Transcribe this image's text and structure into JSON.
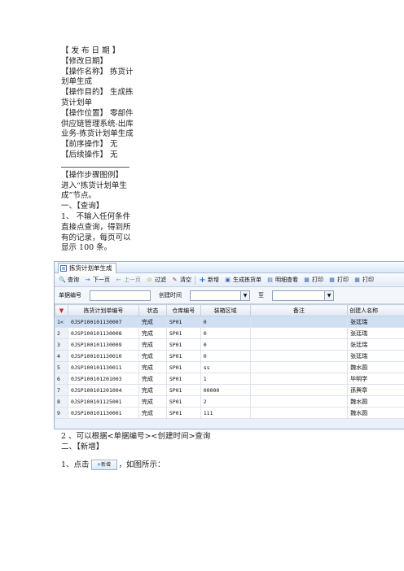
{
  "doc": {
    "lines": [
      "【 发 布 日 期 】",
      "【修改日期】",
      "【操作名称】 拣货计划单生成",
      "【操作目的】 生成拣货计划单",
      "【操作位置】 零部件供应链管理系统-出库业务-拣货计划单生成",
      "【前序操作】 无",
      "【后续操作】 无"
    ],
    "lines2": [
      "【操作步骤图例】",
      "进入“拣货计划单生成”节点。",
      "一、【查询】",
      "1、 不输入任何条件直接点查询，得到所有的记录，每页可以显示 100 条。"
    ],
    "after1": "2 、可以根据<单据编号><创建时间>查询",
    "after2": "二、【新增】",
    "after3_pre": "1、点击",
    "after3_btn": "新增",
    "after3_post": "，如图所示："
  },
  "app": {
    "tab_title": "拣货计划单生成",
    "toolbar": [
      {
        "icon": "search-icon",
        "label": "查询",
        "glyph": "🔍"
      },
      {
        "icon": "next-page-icon",
        "label": "下一页",
        "glyph": "→"
      },
      {
        "icon": "prev-page-icon",
        "label": "上一页",
        "glyph": "←"
      },
      {
        "icon": "filter-icon",
        "label": "过滤",
        "glyph": "⊙"
      },
      {
        "icon": "clear-icon",
        "label": "清空",
        "glyph": "✎"
      },
      {
        "icon": "add-icon",
        "label": "新增",
        "glyph": "+"
      },
      {
        "icon": "generate-icon",
        "label": "生成拣货单",
        "glyph": "▣"
      },
      {
        "icon": "detail-icon",
        "label": "明细查看",
        "glyph": "▤"
      },
      {
        "icon": "print-icon",
        "label": "打印",
        "glyph": "▦"
      },
      {
        "icon": "print-icon",
        "label": "打印",
        "glyph": "▦"
      },
      {
        "icon": "print-icon",
        "label": "打印",
        "glyph": "▦"
      }
    ],
    "filter": {
      "doc_no_label": "单据编号",
      "doc_no_value": "",
      "create_time_label": "创建时间",
      "to_label": "至"
    },
    "columns": [
      "",
      "拣货计划单编号",
      "状态",
      "仓库编号",
      "装箱区域",
      "备注",
      "创建人名称"
    ],
    "rows": [
      [
        "1",
        "0JSP100101130007",
        "完成",
        "SP01",
        "0",
        "",
        "张廷瑞"
      ],
      [
        "2",
        "0JSP100101130008",
        "完成",
        "SP01",
        "0",
        "",
        "张廷瑞"
      ],
      [
        "3",
        "0JSP100101130009",
        "完成",
        "SP01",
        "0",
        "",
        "张廷瑞"
      ],
      [
        "4",
        "0JSP100101130010",
        "完成",
        "SP01",
        "0",
        "",
        "张廷瑞"
      ],
      [
        "5",
        "0JSP100101130011",
        "完成",
        "SP01",
        "ss",
        "",
        "魏水圆"
      ],
      [
        "6",
        "0JSP100101201003",
        "完成",
        "SP01",
        "1",
        "",
        "毕明学"
      ],
      [
        "7",
        "0JSP100101201004",
        "完成",
        "SP01",
        "00000",
        "",
        "孫興章"
      ],
      [
        "8",
        "0JSP100101125001",
        "完成",
        "SP01",
        "2",
        "",
        "魏水圆"
      ],
      [
        "9",
        "0JSP100101130001",
        "完成",
        "SP01",
        "111",
        "",
        "魏水圆"
      ]
    ],
    "filter_icon_glyph": "▼",
    "selected_row_marker": "<"
  }
}
